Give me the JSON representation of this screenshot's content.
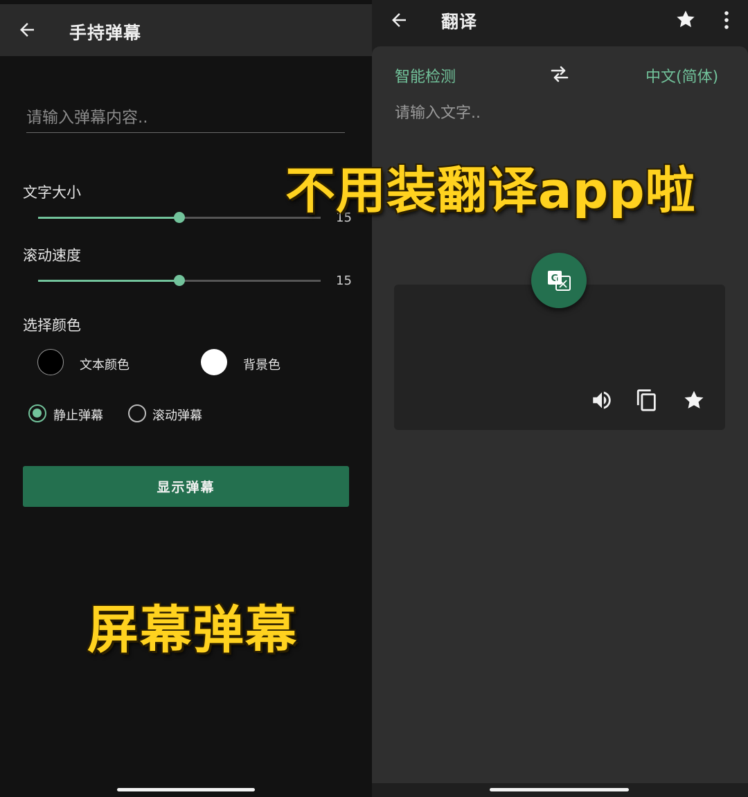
{
  "left": {
    "title": "手持弹幕",
    "input_placeholder": "请输入弹幕内容..",
    "font_size": {
      "label": "文字大小",
      "value": "15",
      "fraction": 0.5
    },
    "scroll_speed": {
      "label": "滚动速度",
      "value": "15",
      "fraction": 0.5
    },
    "color_section": "选择颜色",
    "text_color": {
      "label": "文本颜色",
      "color": "#000000"
    },
    "bg_color": {
      "label": "背景色",
      "color": "#ffffff"
    },
    "modes": [
      {
        "label": "静止弹幕",
        "selected": true
      },
      {
        "label": "滚动弹幕",
        "selected": false
      }
    ],
    "show_button": "显示弹幕",
    "overlay_caption": "屏幕弹幕"
  },
  "right": {
    "title": "翻译",
    "source_lang": "智能检测",
    "target_lang": "中文(简体)",
    "input_placeholder": "请输入文字..",
    "overlay_caption": "不用装翻译app啦"
  },
  "icons": {
    "back": "arrow-left-icon",
    "star": "star-icon",
    "more": "more-vert-icon",
    "swap": "swap-icon",
    "translate": "translate-icon",
    "speaker": "volume-icon",
    "copy": "copy-icon"
  },
  "colors": {
    "accent": "#72c39b",
    "button": "#24704f",
    "overlay_text": "#ffd21f"
  }
}
